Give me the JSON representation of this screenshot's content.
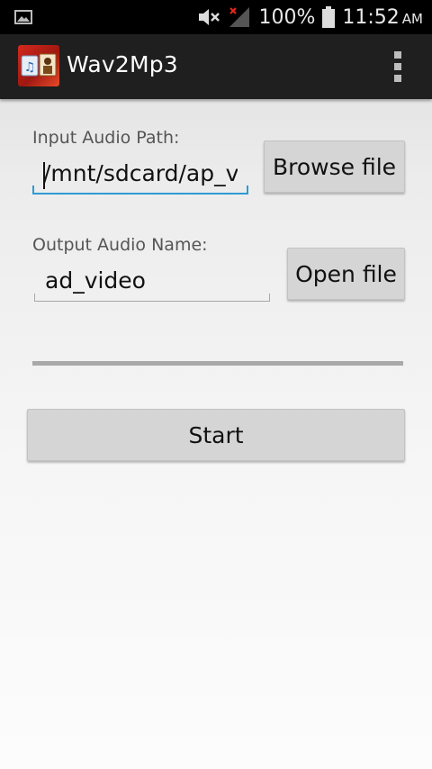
{
  "status_bar": {
    "battery": "100%",
    "time": "11:52",
    "ampm": "AM",
    "icons": [
      "image-notification-icon",
      "mute-icon",
      "no-signal-icon",
      "battery-icon"
    ]
  },
  "action_bar": {
    "title": "Wav2Mp3",
    "app_icon": "wav2mp3-app-icon",
    "overflow_icon": "overflow-menu-icon"
  },
  "form": {
    "input_label": "Input Audio Path:",
    "input_value": "/mnt/sdcard/ap_v",
    "browse_button": "Browse file",
    "output_label": "Output Audio Name:",
    "output_value": "ad_video",
    "open_button": "Open file",
    "progress": 0,
    "start_button": "Start"
  },
  "colors": {
    "accent": "#2f9ad3",
    "actionbar": "#1f1f1f",
    "app_icon": "#c62a1c"
  }
}
